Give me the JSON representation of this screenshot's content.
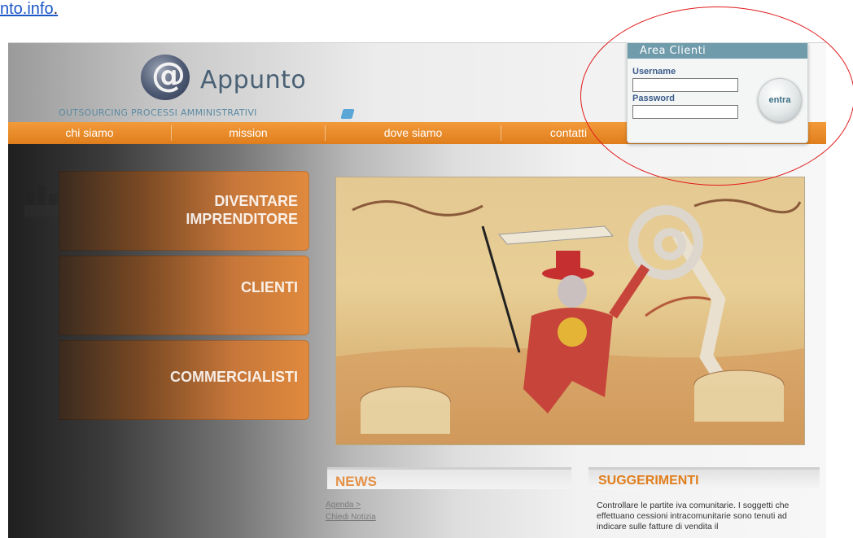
{
  "page": {
    "link_text": "nto.info",
    "link_suffix": "."
  },
  "header": {
    "logo_symbol": "@",
    "logo_title": "Appunto",
    "tagline": "OUTSOURCING PROCESSI AMMINISTRATIVI"
  },
  "nav": {
    "items": [
      "chi siamo",
      "mission",
      "dove siamo",
      "contatti"
    ]
  },
  "login": {
    "title": "Area Clienti",
    "username_label": "Username",
    "password_label": "Password",
    "username_value": "",
    "password_value": "",
    "submit_label": "entra"
  },
  "side_menu": [
    {
      "label_line1": "DIVENTARE",
      "label_line2": "IMPRENDITORE"
    },
    {
      "label_line1": "CLIENTI",
      "label_line2": ""
    },
    {
      "label_line1": "COMMERCIALISTI",
      "label_line2": ""
    }
  ],
  "news": {
    "title": "NEWS",
    "links": [
      "Agenda >",
      "Chiedi Notizia"
    ]
  },
  "suggestions": {
    "title": "SUGGERIMENTI",
    "text": "Controllare le partite iva comunitarie. I soggetti che effettuano cessioni intracomunitarie sono tenuti ad indicare sulle fatture di vendita il"
  },
  "colors": {
    "orange": "#e8862a",
    "login_header": "#6f9bab",
    "annotation": "#e11b1b",
    "link": "#1a56c7"
  }
}
